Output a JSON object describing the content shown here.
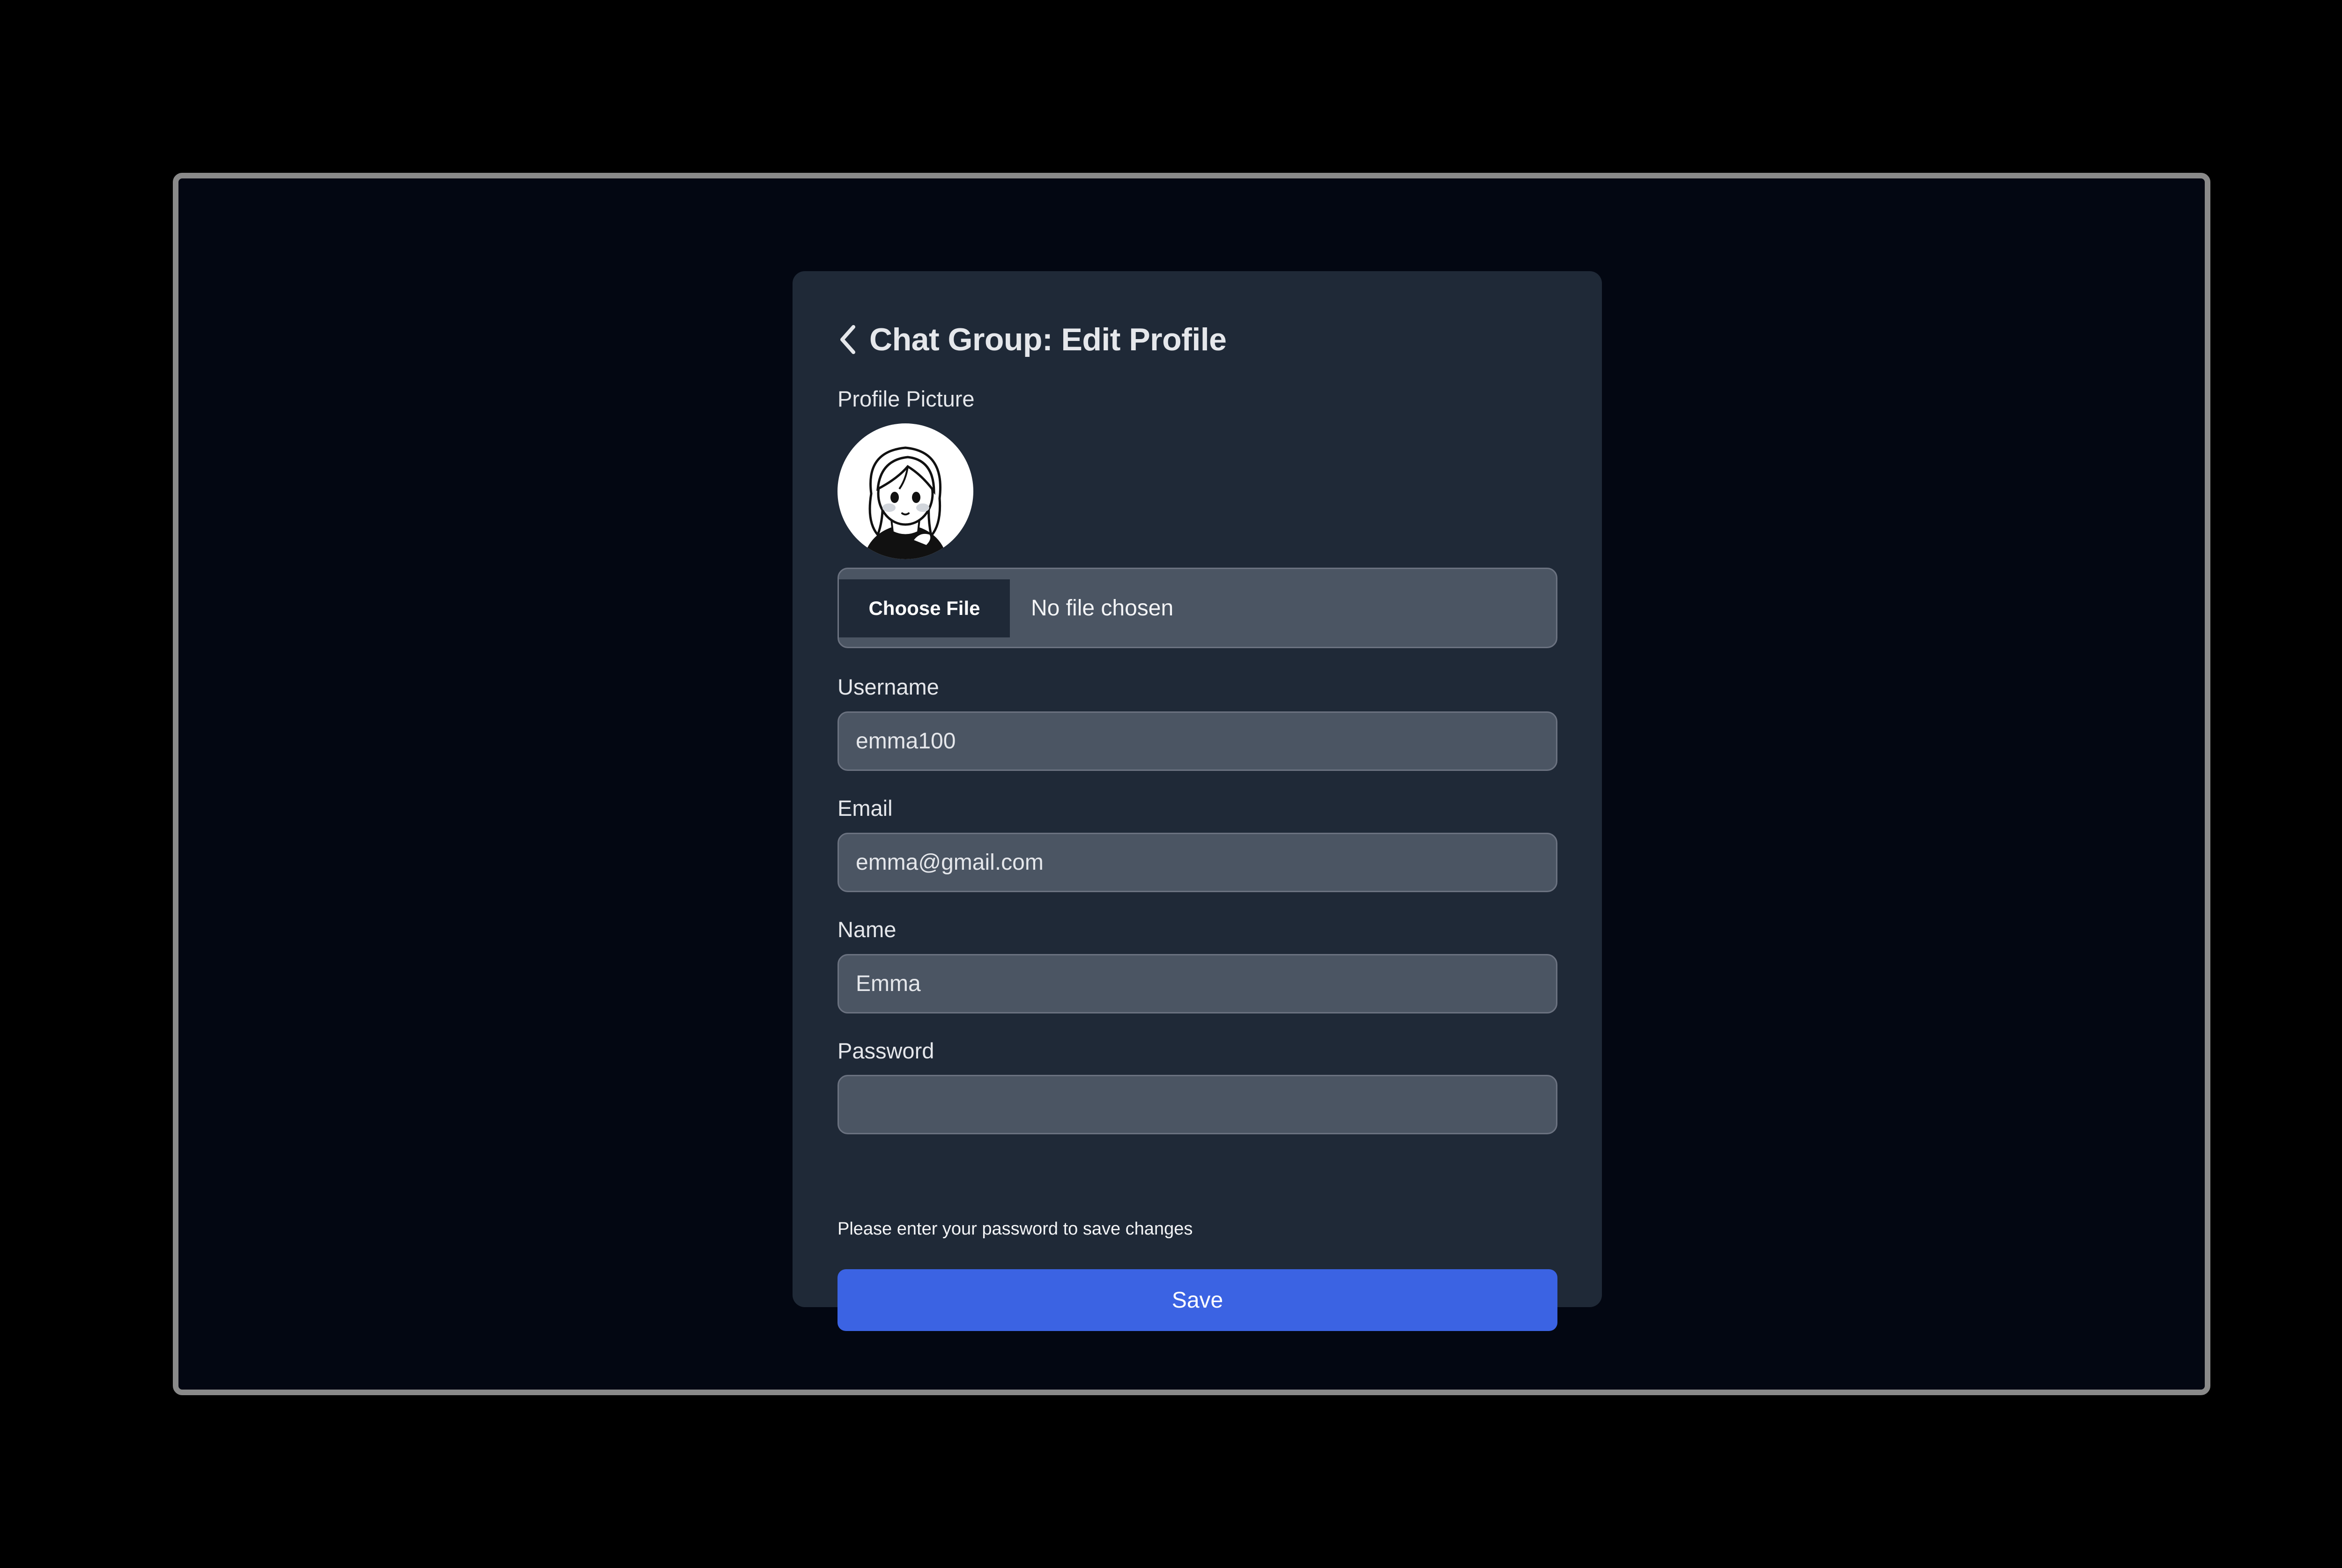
{
  "header": {
    "title": "Chat Group: Edit Profile",
    "back_icon": "chevron-left-icon"
  },
  "profile_picture": {
    "label": "Profile Picture",
    "avatar": "illustrated-girl-avatar",
    "choose_button_label": "Choose File",
    "file_status": "No file chosen"
  },
  "form": {
    "username": {
      "label": "Username",
      "value": "emma100"
    },
    "email": {
      "label": "Email",
      "value": "emma@gmail.com"
    },
    "name": {
      "label": "Name",
      "value": "Emma"
    },
    "password": {
      "label": "Password",
      "value": ""
    },
    "password_hint": "Please enter your password to save changes",
    "save_label": "Save"
  },
  "colors": {
    "page_background": "#030712",
    "card_background": "#1f2937",
    "input_background": "#4b5563",
    "primary_button": "#3b63e3",
    "text": "#e5e7eb"
  }
}
